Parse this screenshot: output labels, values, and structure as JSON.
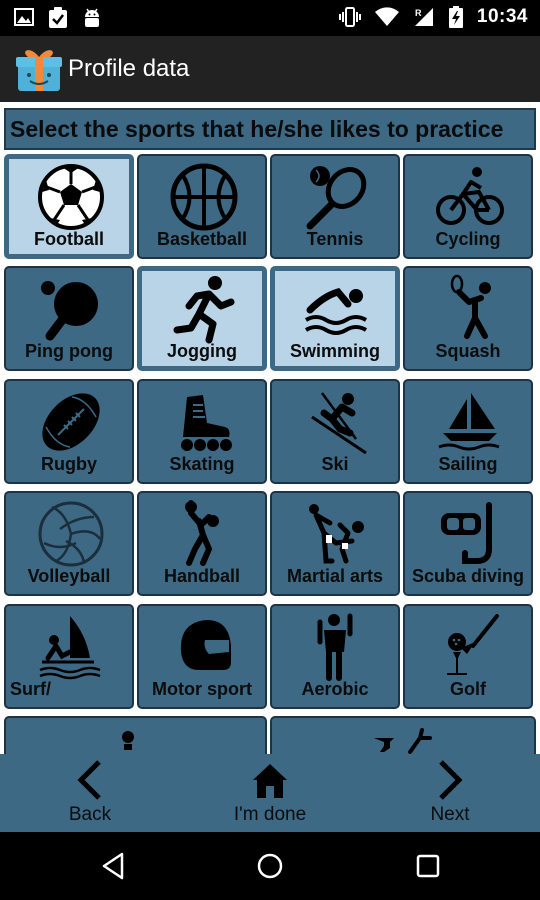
{
  "status_bar": {
    "time": "10:34"
  },
  "app_bar": {
    "title": "Profile data"
  },
  "header": {
    "text": "Select the sports that he/she likes to practice"
  },
  "sports": [
    {
      "label": "Football",
      "icon": "soccer-ball-icon",
      "selected": true
    },
    {
      "label": "Basketball",
      "icon": "basketball-icon",
      "selected": false
    },
    {
      "label": "Tennis",
      "icon": "tennis-racket-icon",
      "selected": false
    },
    {
      "label": "Cycling",
      "icon": "cyclist-icon",
      "selected": false
    },
    {
      "label": "Ping pong",
      "icon": "ping-pong-paddle-icon",
      "selected": false
    },
    {
      "label": "Jogging",
      "icon": "runner-icon",
      "selected": true
    },
    {
      "label": "Swimming",
      "icon": "swimmer-icon",
      "selected": true
    },
    {
      "label": "Squash",
      "icon": "squash-player-icon",
      "selected": false
    },
    {
      "label": "Rugby",
      "icon": "rugby-ball-icon",
      "selected": false
    },
    {
      "label": "Skating",
      "icon": "inline-skate-icon",
      "selected": false
    },
    {
      "label": "Ski",
      "icon": "skier-icon",
      "selected": false
    },
    {
      "label": "Sailing",
      "icon": "sailboat-icon",
      "selected": false
    },
    {
      "label": "Volleyball",
      "icon": "volleyball-icon",
      "selected": false
    },
    {
      "label": "Handball",
      "icon": "handball-player-icon",
      "selected": false
    },
    {
      "label": "Martial arts",
      "icon": "martial-arts-icon",
      "selected": false
    },
    {
      "label": "Scuba diving",
      "icon": "scuba-mask-icon",
      "selected": false
    },
    {
      "label": "Surf/",
      "icon": "windsurf-icon",
      "selected": false
    },
    {
      "label": "Motor sport",
      "icon": "helmet-icon",
      "selected": false
    },
    {
      "label": "Aerobic",
      "icon": "aerobic-figure-icon",
      "selected": false
    },
    {
      "label": "Golf",
      "icon": "golf-club-icon",
      "selected": false
    }
  ],
  "bottom_nav": {
    "back": "Back",
    "done": "I'm done",
    "next": "Next"
  },
  "colors": {
    "tile": "#3d6985",
    "tile_selected": "#b9d3e7",
    "app_bar": "#222222"
  }
}
